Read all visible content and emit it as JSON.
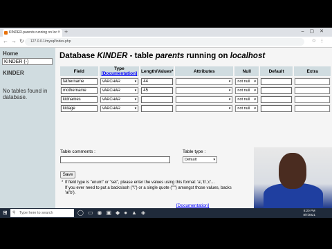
{
  "browser": {
    "tab_title": "KINDER.parents running on loc",
    "tab_close": "×",
    "new_tab": "+",
    "window_controls": "–▢✕",
    "nav_icons": "←→↻",
    "url": "127.0.0.1/mysql/index.php",
    "toolbar_icons": "☆⋮"
  },
  "left": {
    "home": "Home",
    "db_select": "KINDER (-)",
    "db_name": "KINDER",
    "note": "No tables found in database."
  },
  "main": {
    "title_pre": "Database ",
    "title_db": "KINDER",
    "title_mid": " - table ",
    "title_table": "parents",
    "title_mid2": " running on ",
    "title_host": "localhost",
    "headers": {
      "field": "Field",
      "type": "Type",
      "type_doc": "[Documentation]",
      "length": "Length/Values*",
      "attributes": "Attributes",
      "null": "Null",
      "default": "Default",
      "extra": "Extra"
    },
    "rows": [
      {
        "field": "fathername",
        "type": "VARCHAR",
        "length": "44",
        "attributes": "",
        "null": "not null",
        "default": ""
      },
      {
        "field": "mothername",
        "type": "VARCHAR",
        "length": "45",
        "attributes": "",
        "null": "not null",
        "default": ""
      },
      {
        "field": "kidnames",
        "type": "VARCHAR",
        "length": "",
        "attributes": "",
        "null": "not null",
        "default": ""
      },
      {
        "field": "kidage",
        "type": "VARCHAR",
        "length": "",
        "attributes": "",
        "null": "not null",
        "default": ""
      }
    ],
    "comments_label": "Table comments :",
    "tabletype_label": "Table type :",
    "tabletype_value": "Default",
    "save": "Save",
    "hint_star": "*",
    "hint1": "If field type is \"enum\" or \"set\", please enter the values using this format: 'a','b','c'...",
    "hint2": "If you ever need to put a backslash (\"\\\") or a single quote (\"'\") amongst those values, backs",
    "hint3": "'a\\'b').",
    "doc_link": "[Documentation]"
  },
  "taskbar": {
    "search_placeholder": "Type here to search",
    "time": "8:20 PM",
    "date": "8/7/2021"
  },
  "icons": {
    "search": "⚲",
    "windows": "⊞",
    "dropdown": "▾",
    "taskbar_apps": "◯▭◉▣◆●▲◈"
  }
}
